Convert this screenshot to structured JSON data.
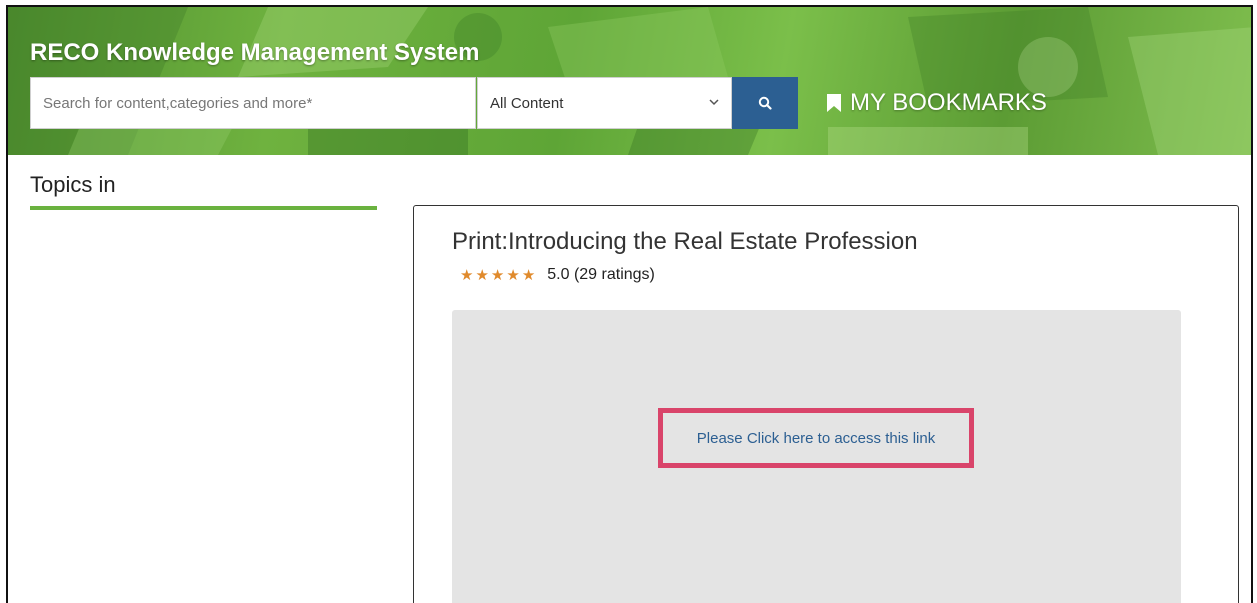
{
  "header": {
    "app_title": "RECO Knowledge Management System",
    "search_placeholder": "Search for content,categories and more*",
    "search_value": "",
    "content_filter": "All Content",
    "bookmarks_label": "MY BOOKMARKS",
    "search_button_color": "#2c5f92"
  },
  "sidebar": {
    "title": "Topics in",
    "underline_color": "#6ab23f"
  },
  "article": {
    "title": "Print:Introducing the Real Estate Profession",
    "rating_value": 5,
    "rating_text": "5.0 (29 ratings)",
    "star_color": "#e08a2c",
    "access_link_label": "Please Click here to access this link",
    "highlight_color": "#d9446a"
  },
  "icons": {
    "search": "search-icon",
    "bookmark": "bookmark-icon",
    "dropdown": "chevron-down-icon",
    "star": "star-icon"
  }
}
